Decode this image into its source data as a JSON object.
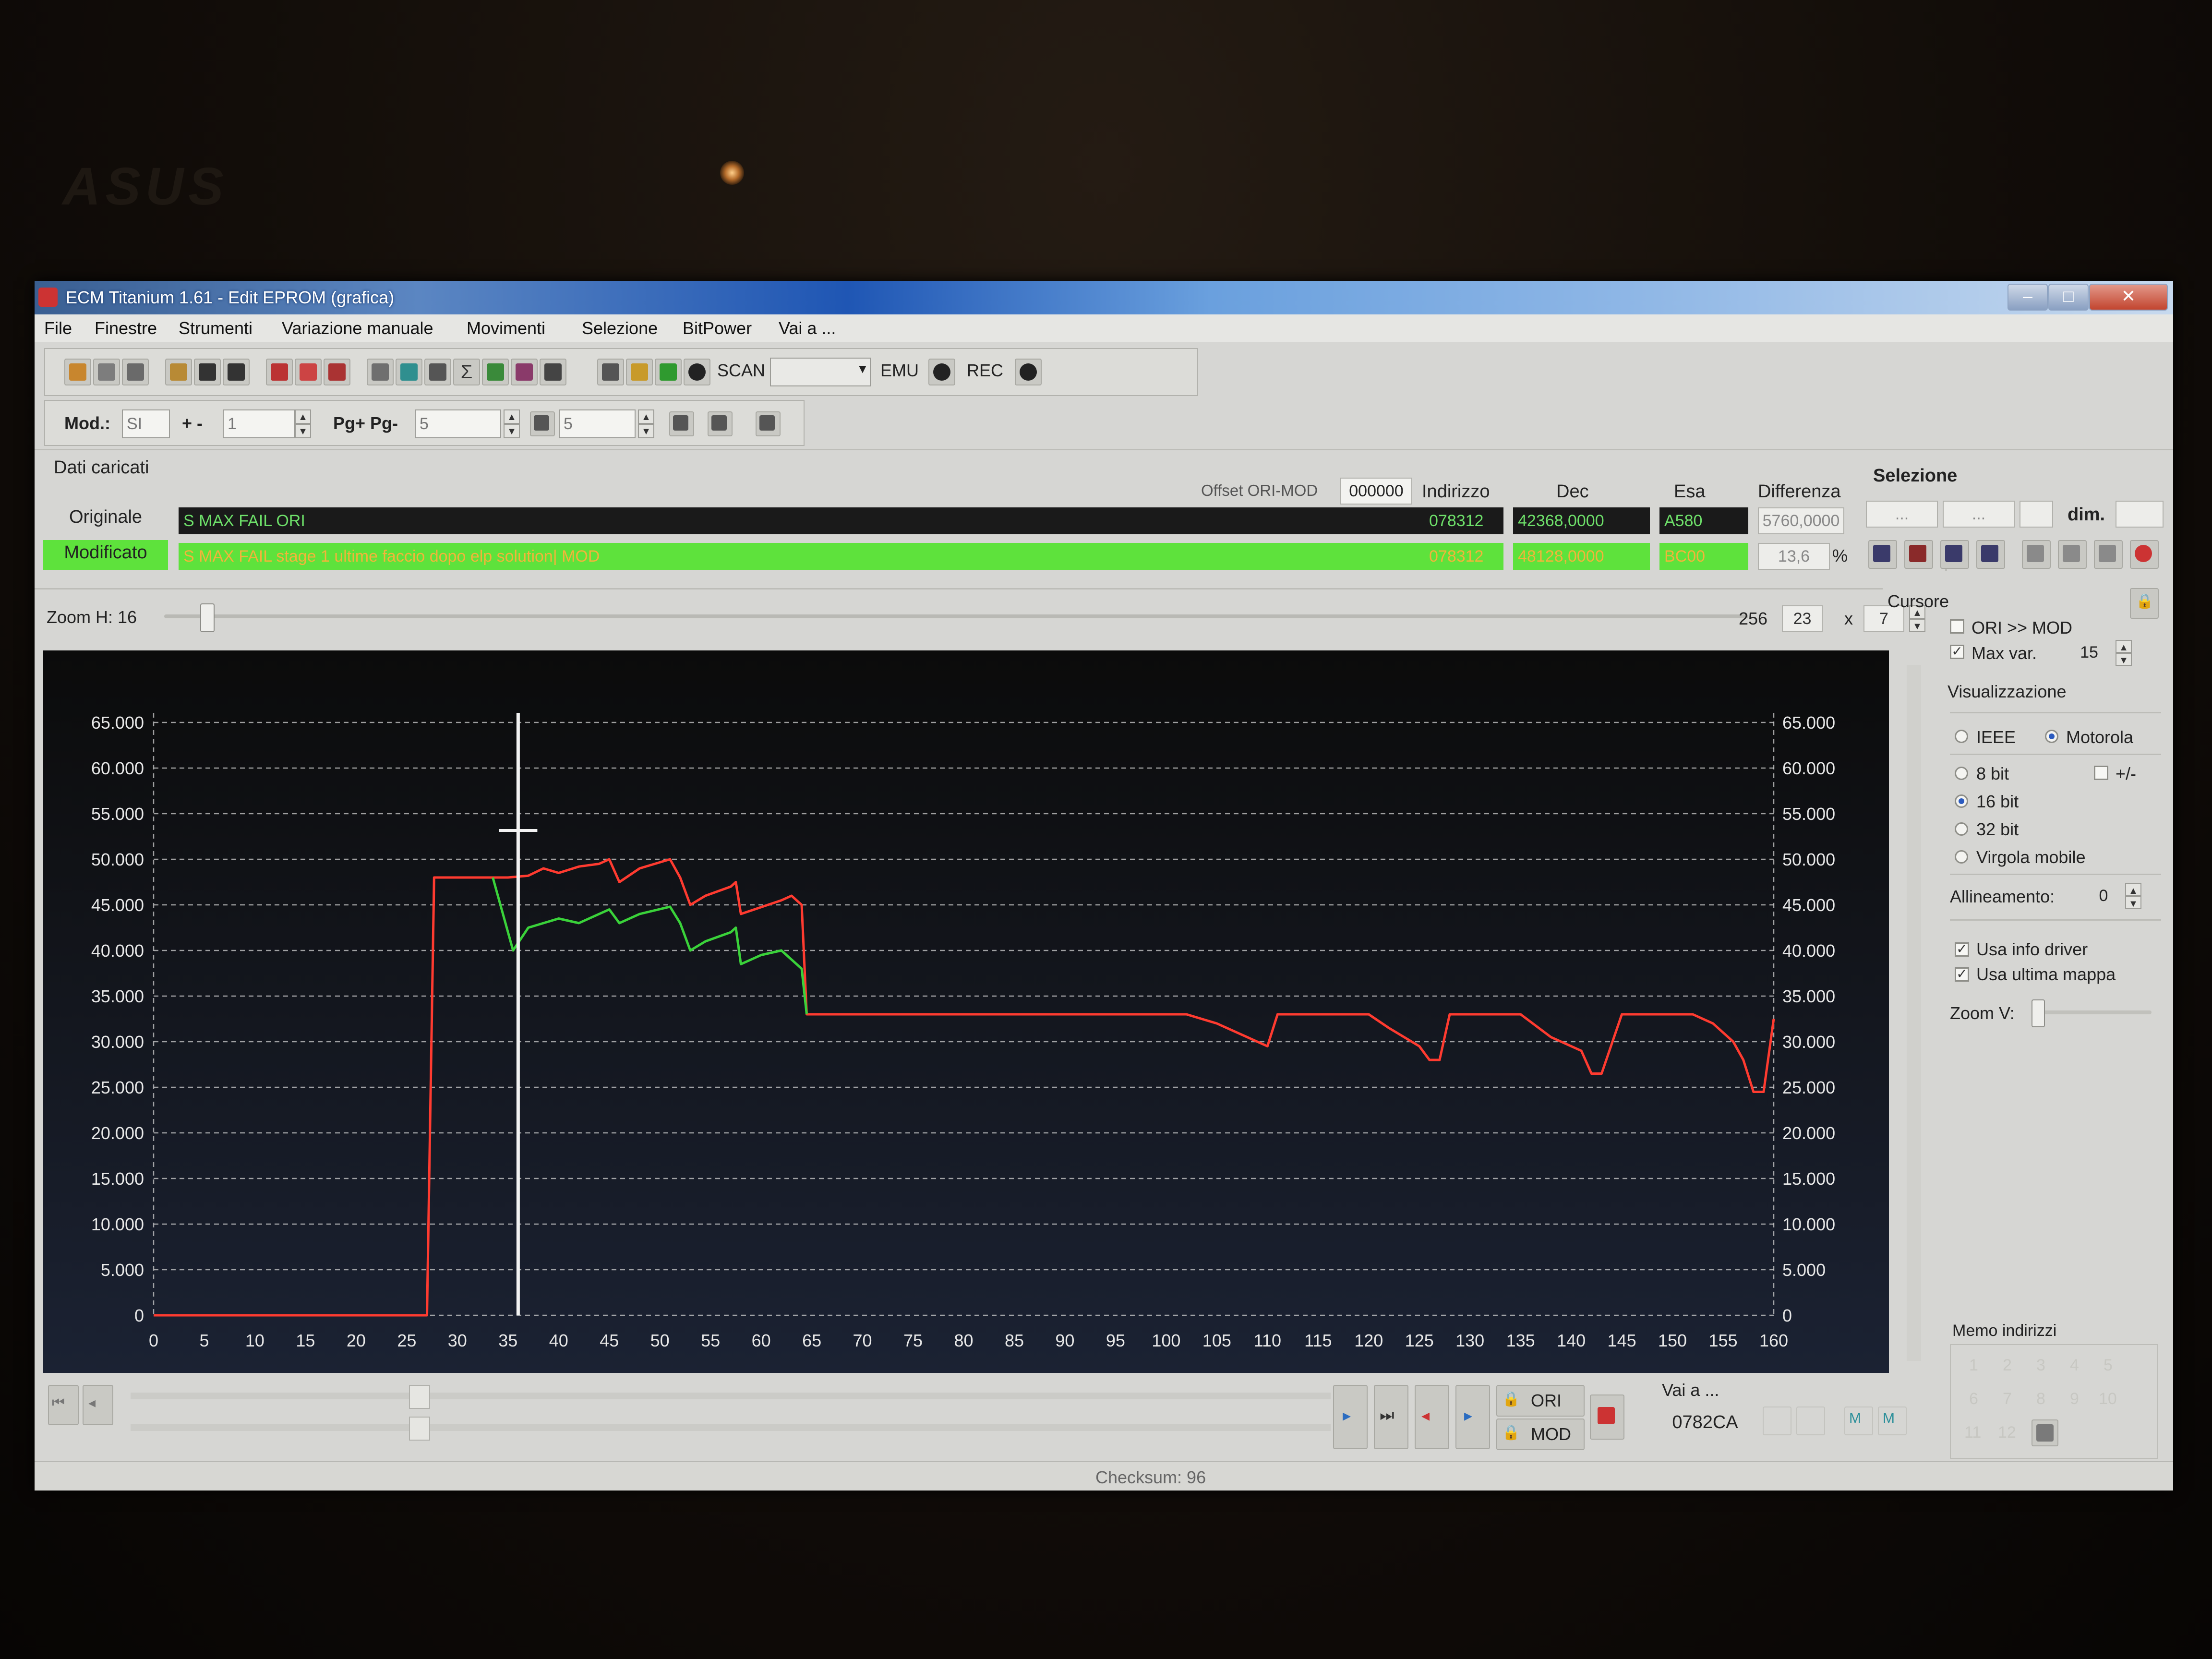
{
  "bezel": {
    "brand": "ASUS"
  },
  "window": {
    "title": "ECM Titanium 1.61 - Edit EPROM (grafica)",
    "min": "–",
    "max": "□",
    "close": "✕"
  },
  "menu": [
    "File",
    "Finestre",
    "Strumenti",
    "Variazione manuale",
    "Movimenti",
    "Selezione",
    "BitPower",
    "Vai a ..."
  ],
  "toolbar": {
    "scan": "SCAN",
    "emu": "EMU",
    "rec": "REC"
  },
  "toolbar2": {
    "mod_label": "Mod.:",
    "mod_value": "SI",
    "plusminus_label": "+ -",
    "plusminus_value": "1",
    "pg_label": "Pg+ Pg-",
    "pg_value": "5",
    "p_value": "5"
  },
  "loaded": {
    "section_title": "Dati caricati",
    "offset_label": "Offset ORI-MOD",
    "offset_value": "000000",
    "col_address": "Indirizzo",
    "col_dec": "Dec",
    "col_hex": "Esa",
    "col_diff": "Differenza",
    "original_label": "Originale",
    "original_name": "S MAX FAIL ORI",
    "original_address": "078312",
    "original_dec": "42368,0000",
    "original_hex": "A580",
    "diff_value": "5760,0000",
    "modified_label": "Modificato",
    "modified_name": "S MAX FAIL stage 1 ultime faccio dopo elp solution| MOD",
    "modified_address": "078312",
    "modified_dec": "48128,0000",
    "modified_hex": "BC00",
    "diff_percent": "13,6",
    "percent_sign": "%"
  },
  "zoom": {
    "label": "Zoom H: 16",
    "value": "256",
    "cols": "23",
    "times": "x",
    "rows": "7"
  },
  "chart_data": {
    "type": "line",
    "x_ticks": [
      0,
      5,
      10,
      15,
      20,
      25,
      30,
      35,
      40,
      45,
      50,
      55,
      60,
      65,
      70,
      75,
      80,
      85,
      90,
      95,
      100,
      105,
      110,
      115,
      120,
      125,
      130,
      135,
      140,
      145,
      150,
      155,
      160
    ],
    "y_ticks_left": [
      "65.000",
      "60.000",
      "55.000",
      "50.000",
      "45.000",
      "40.000",
      "35.000",
      "30.000",
      "25.000",
      "20.000",
      "15.000",
      "10.000",
      "5.000",
      "0"
    ],
    "y_ticks_right": [
      "65.000",
      "60.000",
      "55.000",
      "50.000",
      "45.000",
      "40.000",
      "35.000",
      "30.000",
      "25.000",
      "20.000",
      "15.000",
      "10.000",
      "5.000",
      "0"
    ],
    "xlim": [
      0,
      160
    ],
    "ylim": [
      0,
      65000
    ],
    "grid": true,
    "cursor_x": 36,
    "series": [
      {
        "color": "#ff3b30",
        "x": [
          0,
          27,
          27.7,
          33.5,
          35,
          37,
          38.5,
          40,
          42,
          44,
          45,
          46,
          48,
          51,
          52,
          53,
          54.5,
          57,
          57.5,
          58,
          62,
          63,
          64,
          64.5,
          65,
          70,
          80,
          90,
          100,
          102,
          105,
          109,
          110,
          111,
          115,
          120,
          122,
          125,
          126,
          127,
          128,
          130,
          135,
          138,
          141,
          142,
          143,
          145,
          149,
          150,
          152,
          154,
          156,
          157,
          158,
          159,
          160
        ],
        "y": [
          0,
          0,
          48000,
          48000,
          48000,
          48200,
          49000,
          48500,
          49200,
          49500,
          50000,
          47500,
          49000,
          50000,
          48000,
          45000,
          46000,
          47000,
          47500,
          44000,
          45500,
          46000,
          45000,
          33000,
          33000,
          33000,
          33000,
          33000,
          33000,
          33000,
          32000,
          30000,
          29500,
          33000,
          33000,
          33000,
          31500,
          29500,
          28000,
          28000,
          33000,
          33000,
          33000,
          30500,
          29000,
          26500,
          26500,
          33000,
          33000,
          33000,
          33000,
          32000,
          30000,
          28000,
          24500,
          24500,
          32500
        ]
      },
      {
        "color": "#3ad23a",
        "x": [
          33.5,
          34.5,
          35.5,
          37,
          40,
          42,
          44,
          45,
          46,
          48,
          51,
          52,
          53,
          54.5,
          57,
          57.5,
          58,
          60,
          62,
          63,
          64,
          64.5
        ],
        "y": [
          48000,
          44000,
          40000,
          42500,
          43500,
          43000,
          44000,
          44500,
          43000,
          44000,
          44800,
          43000,
          40000,
          41000,
          42000,
          42500,
          38500,
          39500,
          40000,
          39000,
          38000,
          33000
        ]
      }
    ]
  },
  "nav": {
    "ori": "ORI",
    "mod": "MOD",
    "goto_label": "Vai a ...",
    "goto_value": "0782CA"
  },
  "selection": {
    "title": "Selezione",
    "dim_label": "dim.",
    "fields": [
      "...",
      "...",
      "",
      ""
    ]
  },
  "cursor": {
    "title": "Cursore",
    "ori_mod": "ORI >> MOD",
    "max_var": "Max var.",
    "max_var_value": "15"
  },
  "view": {
    "title": "Visualizzazione",
    "ieee": "IEEE",
    "motorola": "Motorola",
    "bit8": "8 bit",
    "sign": "+/-",
    "bit16": "16 bit",
    "bit32": "32 bit",
    "float": "Virgola mobile",
    "align_label": "Allineamento:",
    "align_value": "0",
    "use_driver": "Usa info driver",
    "use_last_map": "Usa ultima mappa",
    "zoomv": "Zoom V:"
  },
  "memo": {
    "title": "Memo indirizzi",
    "slots": [
      "1",
      "2",
      "3",
      "4",
      "5",
      "6",
      "7",
      "8",
      "9",
      "10",
      "11",
      "12"
    ]
  },
  "status": {
    "checksum": "Checksum: 96"
  },
  "colors": {
    "original_line": "#ff3b30",
    "modified_line": "#3ad23a",
    "grid": "#cfcfcf",
    "modified_bg": "#5ee23c"
  }
}
